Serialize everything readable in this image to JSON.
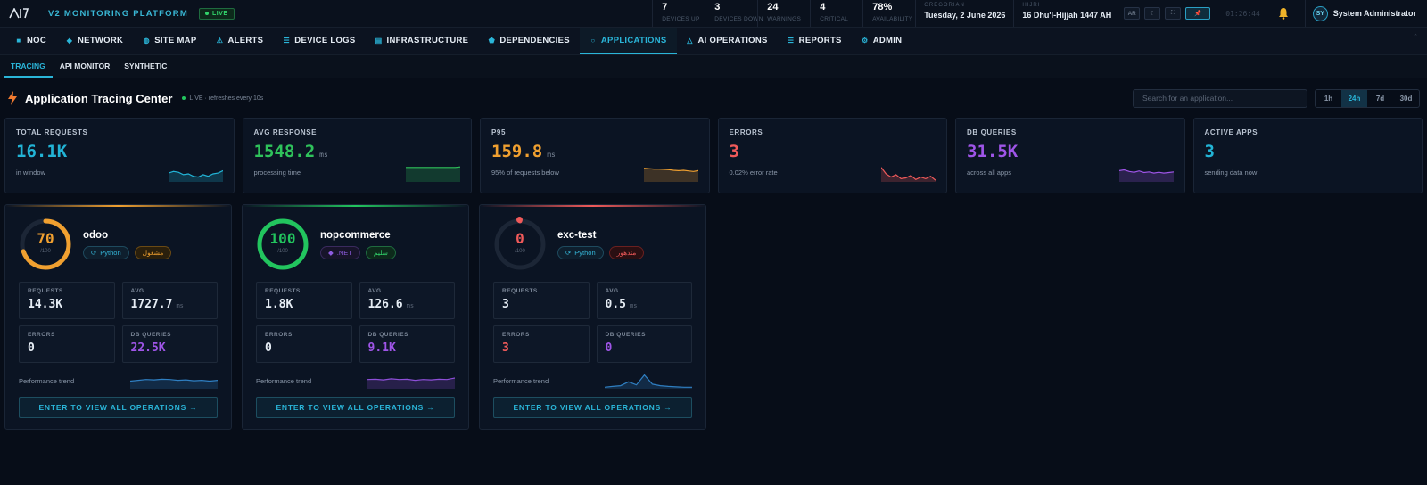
{
  "topbar": {
    "brand": "V2 MONITORING PLATFORM",
    "live": "LIVE",
    "stats": [
      {
        "value": "7",
        "label": "DEVICES UP"
      },
      {
        "value": "3",
        "label": "DEVICES DOWN"
      },
      {
        "value": "24",
        "label": "WARNINGS"
      },
      {
        "value": "4",
        "label": "CRITICAL"
      },
      {
        "value": "78%",
        "label": "AVAILABILITY"
      }
    ],
    "gregorian_label": "GREGORIAN",
    "gregorian_date": "Tuesday, 2 June 2026",
    "hijri_label": "HIJRI",
    "hijri_date": "16 Dhu'l-Hijjah 1447 AH",
    "lang_btn": "AR",
    "clock": "01:26:44",
    "user_initials": "SY",
    "user_name": "System Administrator"
  },
  "nav": {
    "items": [
      {
        "label": "NOC",
        "icon": "grid-icon"
      },
      {
        "label": "NETWORK",
        "icon": "diamond-icon"
      },
      {
        "label": "SITE MAP",
        "icon": "globe-icon"
      },
      {
        "label": "ALERTS",
        "icon": "warning-icon"
      },
      {
        "label": "DEVICE LOGS",
        "icon": "list-icon"
      },
      {
        "label": "INFRASTRUCTURE",
        "icon": "server-icon"
      },
      {
        "label": "DEPENDENCIES",
        "icon": "network-icon"
      },
      {
        "label": "APPLICATIONS",
        "icon": "circle-icon"
      },
      {
        "label": "AI OPERATIONS",
        "icon": "triangle-icon"
      },
      {
        "label": "REPORTS",
        "icon": "list-icon"
      },
      {
        "label": "ADMIN",
        "icon": "gear-icon"
      }
    ],
    "active_index": 7
  },
  "subnav": {
    "items": [
      "TRACING",
      "API MONITOR",
      "SYNTHETIC"
    ]
  },
  "page": {
    "title": "Application Tracing Center",
    "refresh": "LIVE · refreshes every 10s",
    "search_placeholder": "Search for an application...",
    "ranges": [
      "1h",
      "24h",
      "7d",
      "30d"
    ],
    "active_range": "24h"
  },
  "kpis": [
    {
      "label": "TOTAL REQUESTS",
      "value": "16.1K",
      "unit": "",
      "sub": "in window",
      "color": "#22b4d6",
      "spark": [
        0.55,
        0.65,
        0.6,
        0.45,
        0.5,
        0.35,
        0.3,
        0.45,
        0.35,
        0.5,
        0.55,
        0.7
      ]
    },
    {
      "label": "AVG RESPONSE",
      "value": "1548.2",
      "unit": "ms",
      "sub": "processing time",
      "color": "#2fc25b",
      "spark": [
        0.9,
        0.9,
        0.9,
        0.9,
        0.9,
        0.9,
        0.9,
        0.9,
        0.9,
        0.9,
        0.9,
        0.93
      ]
    },
    {
      "label": "P95",
      "value": "159.8",
      "unit": "ms",
      "sub": "95% of requests below",
      "color": "#f0a030",
      "spark": [
        0.85,
        0.82,
        0.8,
        0.8,
        0.78,
        0.76,
        0.72,
        0.7,
        0.72,
        0.68,
        0.65,
        0.7
      ]
    },
    {
      "label": "ERRORS",
      "value": "3",
      "unit": "",
      "sub": "0.02% error rate",
      "color": "#f05a5a",
      "spark": [
        0.9,
        0.5,
        0.3,
        0.45,
        0.2,
        0.25,
        0.4,
        0.15,
        0.3,
        0.2,
        0.35,
        0.1
      ]
    },
    {
      "label": "DB QUERIES",
      "value": "31.5K",
      "unit": "",
      "sub": "across all apps",
      "color": "#9f55e8",
      "spark": [
        0.7,
        0.75,
        0.65,
        0.6,
        0.68,
        0.58,
        0.62,
        0.55,
        0.6,
        0.55,
        0.58,
        0.62
      ]
    },
    {
      "label": "ACTIVE APPS",
      "value": "3",
      "unit": "",
      "sub": "sending data now",
      "color": "#22b4d6",
      "spark": null
    }
  ],
  "apps": [
    {
      "name": "odoo",
      "score": "70",
      "score_max": "/100",
      "score_value": 70,
      "color": "#f0a030",
      "lang": "Python",
      "lang_kind": "python",
      "status": "مشغول",
      "status_kind": "warn",
      "alert": false,
      "requests": "14.3K",
      "avg": "1727.7",
      "avg_unit": "ms",
      "errors": "0",
      "errors_color": "#e6edf5",
      "db": "22.5K",
      "spark_color": "#2f7fc2",
      "spark": [
        0.5,
        0.55,
        0.6,
        0.58,
        0.62,
        0.6,
        0.55,
        0.58,
        0.52,
        0.55,
        0.5,
        0.55
      ]
    },
    {
      "name": "nopcommerce",
      "score": "100",
      "score_max": "/100",
      "score_value": 100,
      "color": "#22c55e",
      "lang": ".NET",
      "lang_kind": "net",
      "status": "سليم",
      "status_kind": "ok",
      "alert": false,
      "requests": "1.8K",
      "avg": "126.6",
      "avg_unit": "ms",
      "errors": "0",
      "errors_color": "#e6edf5",
      "db": "9.1K",
      "spark_color": "#8e4fd8",
      "spark": [
        0.6,
        0.62,
        0.58,
        0.65,
        0.6,
        0.62,
        0.55,
        0.6,
        0.58,
        0.62,
        0.6,
        0.7
      ]
    },
    {
      "name": "exc-test",
      "score": "0",
      "score_max": "/100",
      "score_value": 0,
      "color": "#f05a5a",
      "lang": "Python",
      "lang_kind": "python",
      "status": "متدهور",
      "status_kind": "err",
      "alert": true,
      "requests": "3",
      "avg": "0.5",
      "avg_unit": "ms",
      "errors": "3",
      "errors_color": "#f05a5a",
      "db": "0",
      "spark_color": "#2f7fc2",
      "spark": [
        0.1,
        0.15,
        0.2,
        0.45,
        0.25,
        0.9,
        0.3,
        0.2,
        0.15,
        0.12,
        0.1,
        0.1
      ]
    }
  ],
  "labels": {
    "requests": "REQUESTS",
    "avg": "AVG",
    "errors": "ERRORS",
    "db": "DB QUERIES",
    "trend": "Performance trend",
    "enter": "ENTER TO VIEW ALL OPERATIONS →"
  }
}
